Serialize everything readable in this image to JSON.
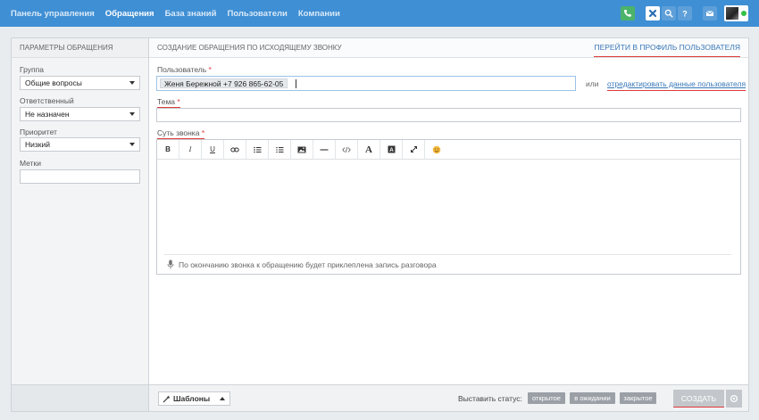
{
  "nav": {
    "items": [
      {
        "label": "Панель управления",
        "active": false
      },
      {
        "label": "Обращения",
        "active": true
      },
      {
        "label": "База знаний",
        "active": false
      },
      {
        "label": "Пользователи",
        "active": false
      },
      {
        "label": "Компании",
        "active": false
      }
    ]
  },
  "topbar_icons": [
    "phone-icon",
    "close-icon",
    "search-icon",
    "help-icon",
    "mail-icon"
  ],
  "colors": {
    "topbar": "#3f8fd4",
    "accent_link": "#3a78b8",
    "required": "#e03a3a",
    "phone_button": "#4cb36a"
  },
  "sidebar": {
    "title": "ПАРАМЕТРЫ ОБРАЩЕНИЯ",
    "group": {
      "label": "Группа",
      "value": "Общие вопросы"
    },
    "assignee": {
      "label": "Ответственный",
      "value": "Не назначен"
    },
    "priority": {
      "label": "Приоритет",
      "value": "Низкий"
    },
    "tags": {
      "label": "Метки",
      "value": ""
    }
  },
  "main": {
    "title": "СОЗДАНИЕ ОБРАЩЕНИЯ ПО ИСХОДЯЩЕМУ ЗВОНКУ",
    "profile_link": "ПЕРЕЙТИ В ПРОФИЛЬ ПОЛЬЗОВАТЕЛЯ",
    "user": {
      "label": "Пользователь",
      "required": "*",
      "value": "Женя Бережной +7 926 865-62-05"
    },
    "or": "или",
    "edit_user_link": "отредактировать данные пользователя",
    "subject": {
      "label": "Тема",
      "required": "*",
      "value": ""
    },
    "body": {
      "label": "Суть звонка",
      "required": "*"
    },
    "toolbar": [
      "B",
      "I",
      "U",
      "link-icon",
      "bulleted-list-icon",
      "numbered-list-icon",
      "image-icon",
      "horizontal-rule-icon",
      "code-icon",
      "A",
      "text-color-icon",
      "fullscreen-icon",
      "emoji-icon"
    ],
    "recording_note": "По окончанию звонка к обращению будет приклеплена запись разговора"
  },
  "footer": {
    "templates": "Шаблоны",
    "status_label": "Выставить статус:",
    "statuses": [
      "открытое",
      "в ожидании",
      "закрытое"
    ],
    "create": "СОЗДАТЬ"
  }
}
